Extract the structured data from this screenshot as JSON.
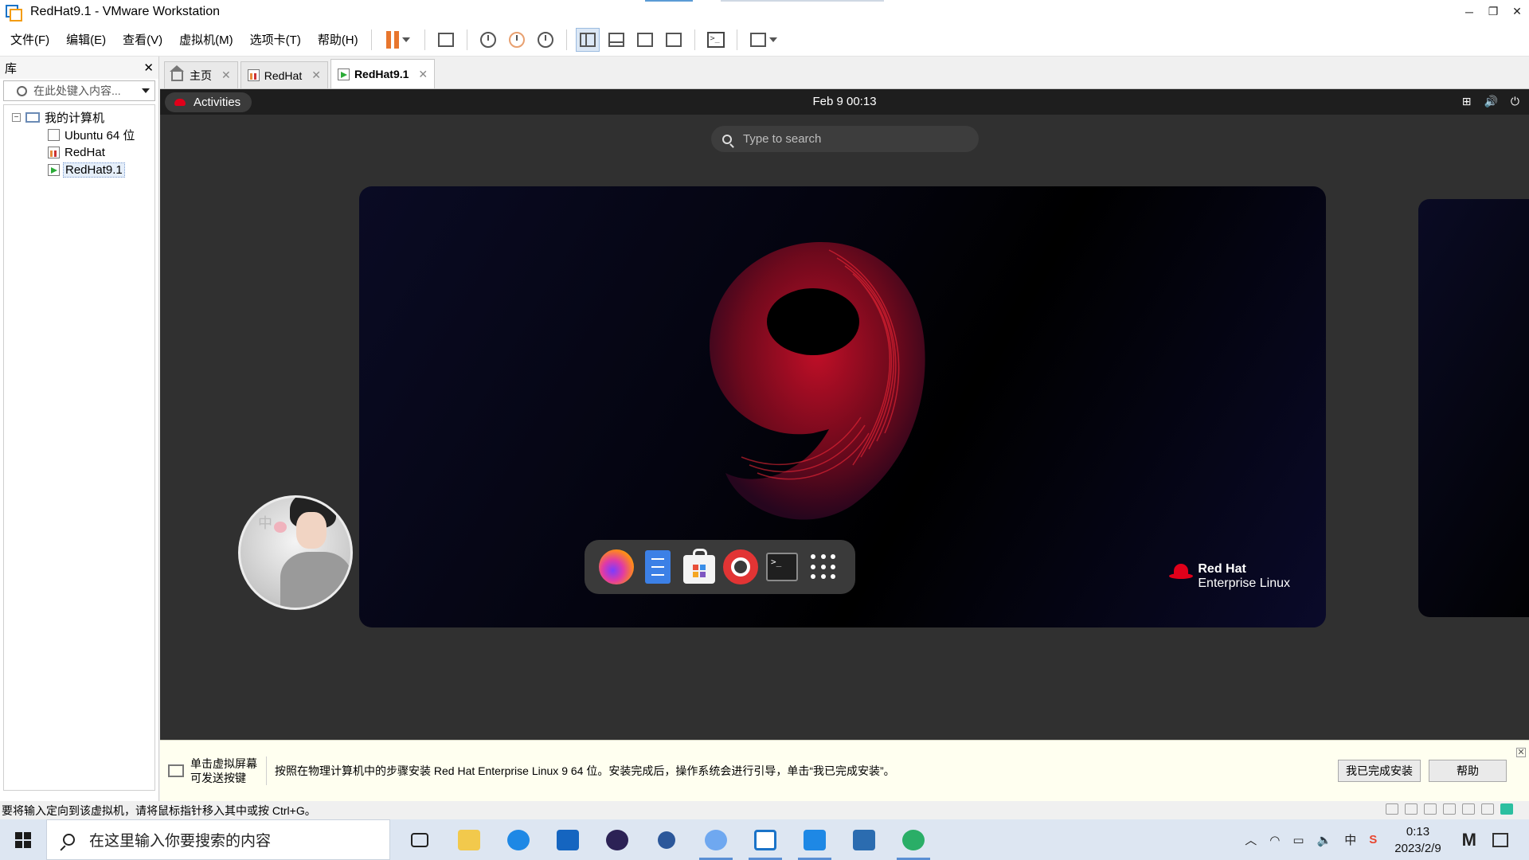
{
  "window": {
    "title": "RedHat9.1 - VMware Workstation"
  },
  "menu": [
    "文件(F)",
    "编辑(E)",
    "查看(V)",
    "虚拟机(M)",
    "选项卡(T)",
    "帮助(H)"
  ],
  "library": {
    "title": "库",
    "search_placeholder": "在此处键入内容...",
    "tree": {
      "root": "我的计算机",
      "items": [
        "Ubuntu 64 位",
        "RedHat",
        "RedHat9.1"
      ],
      "selected": "RedHat9.1"
    }
  },
  "tabs": [
    {
      "label": "主页",
      "icon": "home-icon"
    },
    {
      "label": "RedHat",
      "icon": "vm-icon"
    },
    {
      "label": "RedHat9.1",
      "icon": "vm-running-icon",
      "active": true
    }
  ],
  "guest": {
    "activities": "Activities",
    "clock": "Feb 9  00:13",
    "search_placeholder": "Type to search",
    "brand_line1": "Red Hat",
    "brand_line2": "Enterprise Linux",
    "avatar_glyph": "中",
    "dock": [
      "firefox-icon",
      "files-icon",
      "software-icon",
      "help-icon",
      "terminal-icon",
      "app-grid-icon"
    ],
    "terminal_glyph": ">_"
  },
  "hint": {
    "left_line1": "单击虚拟屏幕",
    "left_line2": "可发送按键",
    "message": "按照在物理计算机中的步骤安装 Red Hat Enterprise Linux 9 64 位。安装完成后，操作系统会进行引导，单击“我已完成安装”。",
    "done_button": "我已完成安装",
    "help_button": "帮助"
  },
  "status": {
    "text": "要将输入定向到该虚拟机，请将鼠标指针移入其中或按 Ctrl+G。"
  },
  "taskbar": {
    "search_placeholder": "在这里输入你要搜索的内容",
    "time": "0:13",
    "date": "2023/2/9",
    "ime": "中",
    "colors": {
      "edge": "#1e88e5",
      "mail": "#1565c0",
      "eclipse": "#2c2255",
      "vmware": "#1a73c8",
      "photos": "#2b6cb0",
      "wechat": "#2aae67"
    }
  }
}
